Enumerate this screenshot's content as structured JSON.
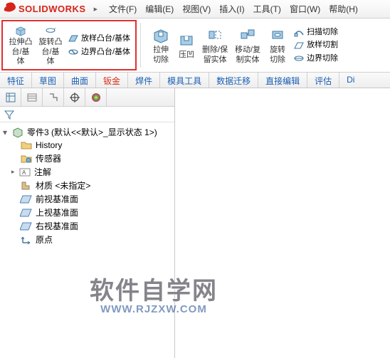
{
  "app": {
    "logo_prefix": "DS",
    "logo_text": "SOLIDWORKS"
  },
  "menu": {
    "file": "文件(F)",
    "edit": "编辑(E)",
    "view": "视图(V)",
    "insert": "插入(I)",
    "tools": "工具(T)",
    "window": "窗口(W)",
    "help": "帮助(H)"
  },
  "ribbon": {
    "extrude_boss": "拉伸凸台/基体",
    "revolve_boss": "旋转凸台/基体",
    "loft_boss": "放样凸台/基体",
    "boundary_boss": "边界凸台/基体",
    "extrude_cut": "拉伸切除",
    "indent": "压凹",
    "delete_keep": "删除/保留实体",
    "move_copy": "移动/复制实体",
    "revolve_cut": "旋转切除",
    "swept_cut": "扫描切除",
    "loft_cut": "放样切割",
    "boundary_cut": "边界切除"
  },
  "tabs": {
    "features": "特征",
    "sketch": "草图",
    "surfaces": "曲面",
    "sheetmetal": "钣金",
    "weldments": "焊件",
    "mold": "模具工具",
    "data": "数据迁移",
    "direct": "直接编辑",
    "evaluate": "评估",
    "di": "Di"
  },
  "tree": {
    "root": "零件3  (默认<<默认>_显示状态 1>)",
    "history": "History",
    "sensors": "传感器",
    "annotations": "注解",
    "material": "材质 <未指定>",
    "front": "前视基准面",
    "top": "上视基准面",
    "right": "右视基准面",
    "origin": "原点"
  },
  "watermark": {
    "big": "软件自学网",
    "small": "WWW.RJZXW.COM"
  }
}
